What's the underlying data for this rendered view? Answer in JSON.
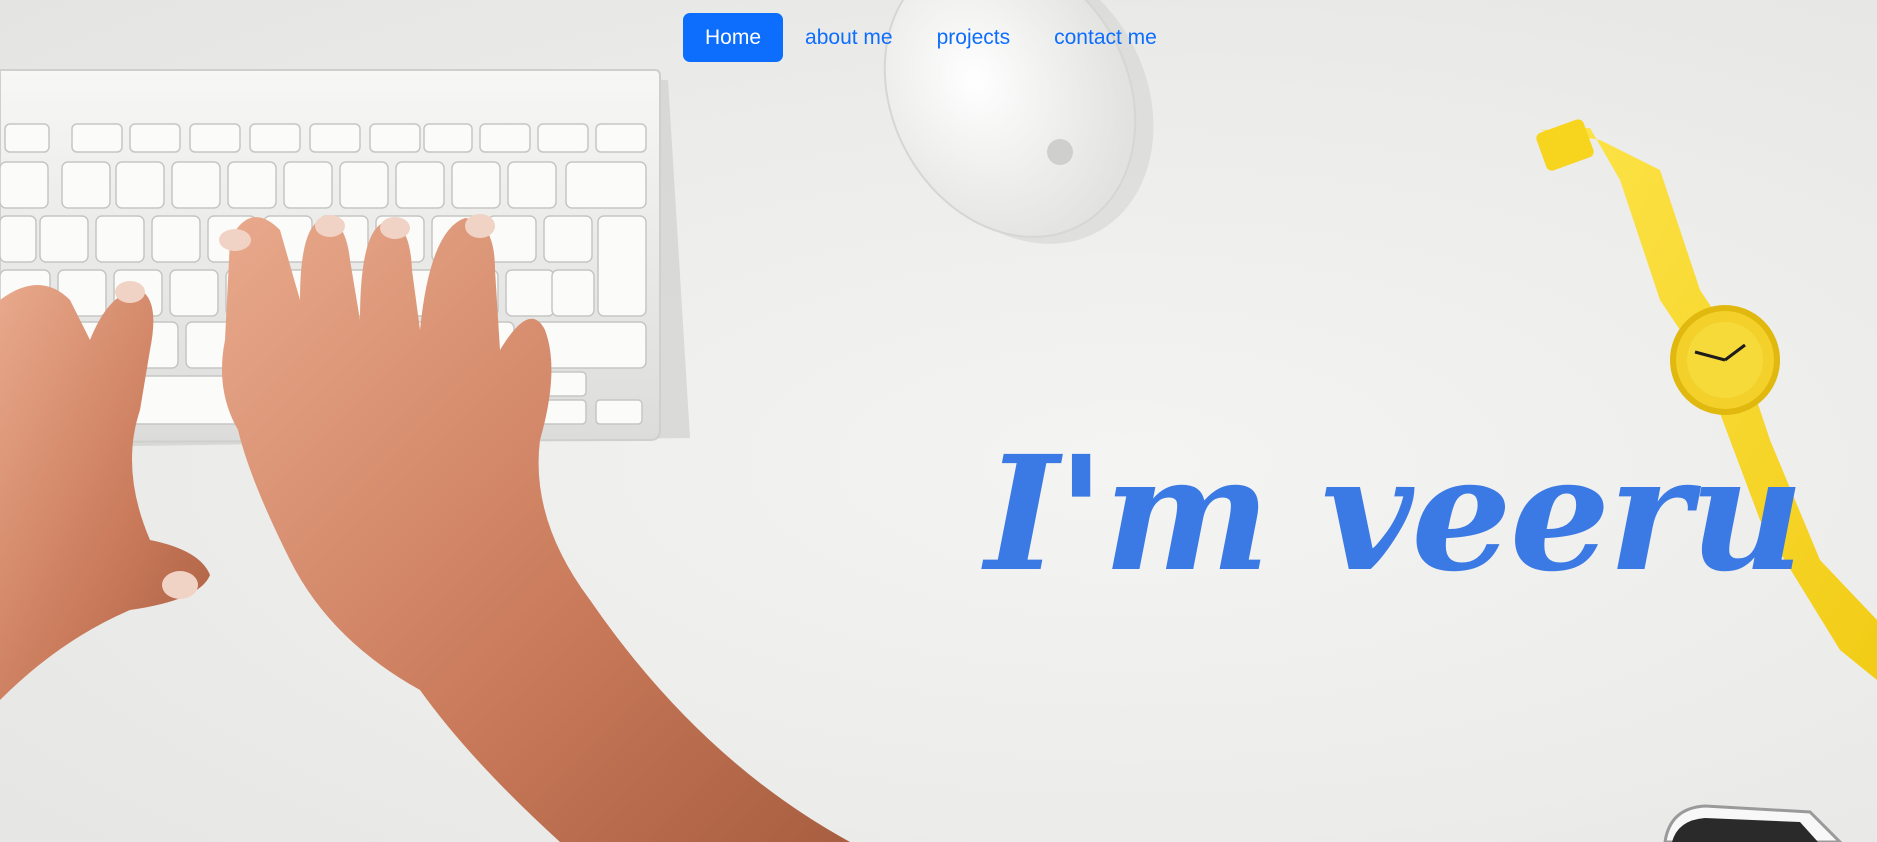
{
  "nav": {
    "items": [
      {
        "label": "Home",
        "active": true
      },
      {
        "label": "about me",
        "active": false
      },
      {
        "label": "projects",
        "active": false
      },
      {
        "label": "contact me",
        "active": false
      }
    ]
  },
  "hero": {
    "headline": "I'm veeru",
    "background_image": "desk-keyboard-hands-mouse-watch-photo"
  },
  "colors": {
    "accent": "#0d6efd",
    "headline": "#3b7ae4",
    "background": "#eeeeec"
  }
}
